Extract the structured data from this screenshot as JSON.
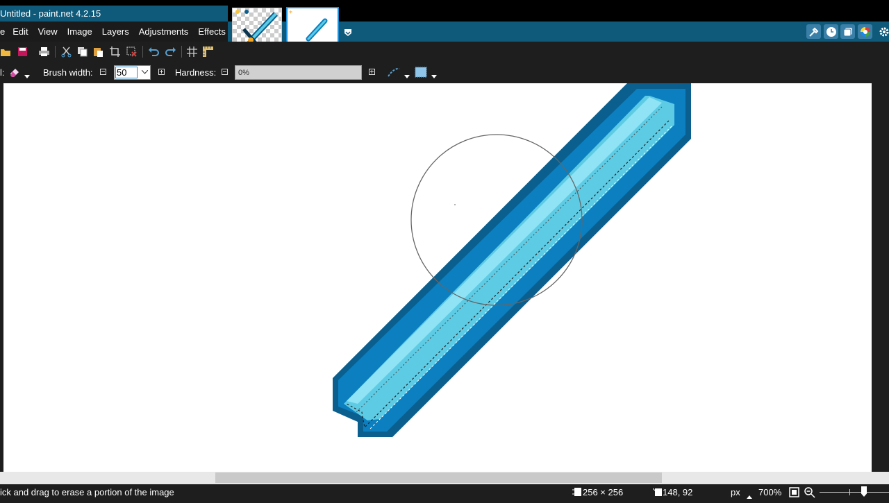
{
  "app": {
    "title": "Untitled - paint.net 4.2.15"
  },
  "menu": {
    "items": [
      "e",
      "Edit",
      "View",
      "Image",
      "Layers",
      "Adjustments",
      "Effects"
    ]
  },
  "toolbar": {
    "icons": [
      "open-icon",
      "save-icon",
      "print-icon",
      "cut-icon",
      "copy-icon",
      "paste-icon",
      "crop-icon",
      "deselect-icon",
      "undo-icon",
      "redo-icon",
      "grid-icon",
      "ruler-icon"
    ]
  },
  "tool_options": {
    "tool_label": "l:",
    "brush_width_label": "Brush width:",
    "brush_width_value": "50",
    "hardness_label": "Hardness:",
    "hardness_value": "0%"
  },
  "status": {
    "hint": "ick and drag to erase a portion of the image",
    "image_size": "256 × 256",
    "cursor_pos": "148, 92",
    "units": "px",
    "zoom": "700%"
  },
  "colors": {
    "accent": "#0f5a7a",
    "selection": "#1c8fd6",
    "sword_dark": "#0a5f8e",
    "sword_mid": "#0b7fc0",
    "sword_light": "#5ecbe4",
    "sword_highlight": "#8fe3f5"
  }
}
